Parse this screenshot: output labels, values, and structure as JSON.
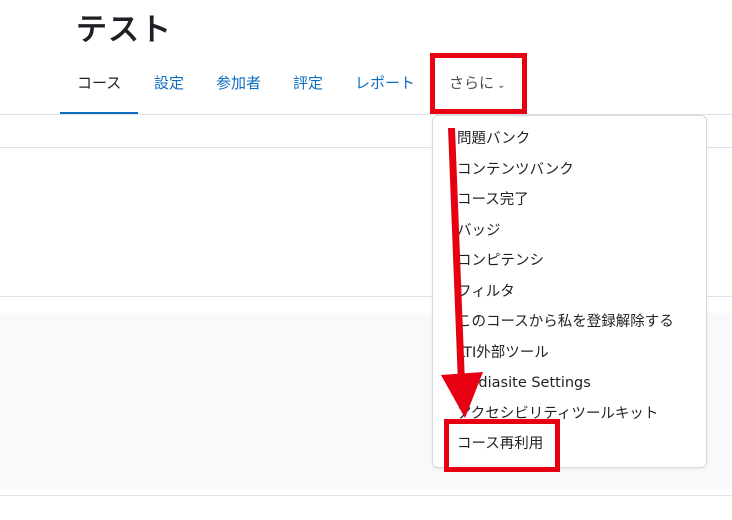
{
  "course": {
    "title": "テスト"
  },
  "nav": {
    "tabs": [
      {
        "label": "コース"
      },
      {
        "label": "設定"
      },
      {
        "label": "参加者"
      },
      {
        "label": "評定"
      },
      {
        "label": "レポート"
      },
      {
        "label": "さらに"
      }
    ]
  },
  "more_menu": {
    "items": [
      {
        "label": "問題バンク"
      },
      {
        "label": "コンテンツバンク"
      },
      {
        "label": "コース完了"
      },
      {
        "label": "バッジ"
      },
      {
        "label": "コンピテンシ"
      },
      {
        "label": "フィルタ"
      },
      {
        "label": "このコースから私を登録解除する"
      },
      {
        "label": "LTI外部ツール"
      },
      {
        "label": "Mediasite Settings"
      },
      {
        "label": "アクセシビリティツールキット"
      },
      {
        "label": "コース再利用"
      }
    ]
  },
  "annotation": {
    "color": "#e60012"
  },
  "colors": {
    "link": "#0f6cbf",
    "text": "#1d2125"
  }
}
